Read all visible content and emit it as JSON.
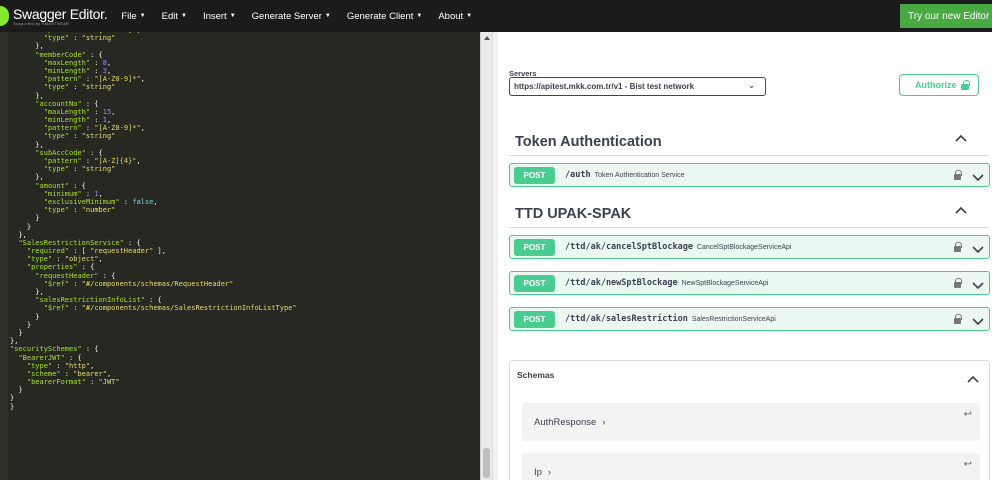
{
  "topbar": {
    "logo_title": "Swagger Editor.",
    "logo_sub": "Supported by SMARTBEAR",
    "menu": [
      "File",
      "Edit",
      "Insert",
      "Generate Server",
      "Generate Client",
      "About"
    ],
    "try_button": "Try our new Editor ↗"
  },
  "editor": {
    "lines": [
      [
        [
          "p",
          "        "
        ],
        [
          "k",
          "\"pattern\""
        ],
        [
          "p",
          " : "
        ],
        [
          "s",
          "\"[A-Z0-9]\""
        ],
        [
          "p",
          ","
        ]
      ],
      [
        [
          "p",
          "        "
        ],
        [
          "k",
          "\"type\""
        ],
        [
          "p",
          " : "
        ],
        [
          "s",
          "\"string\""
        ]
      ],
      [
        [
          "p",
          "      },"
        ]
      ],
      [
        [
          "p",
          "      "
        ],
        [
          "k",
          "\"memberCode\""
        ],
        [
          "p",
          " : {"
        ]
      ],
      [
        [
          "p",
          "        "
        ],
        [
          "k",
          "\"maxLength\""
        ],
        [
          "p",
          " : "
        ],
        [
          "n",
          "8"
        ],
        [
          "p",
          ","
        ]
      ],
      [
        [
          "p",
          "        "
        ],
        [
          "k",
          "\"minLength\""
        ],
        [
          "p",
          " : "
        ],
        [
          "n",
          "3"
        ],
        [
          "p",
          ","
        ]
      ],
      [
        [
          "p",
          "        "
        ],
        [
          "k",
          "\"pattern\""
        ],
        [
          "p",
          " : "
        ],
        [
          "s",
          "\"[A-Z0-9]*\""
        ],
        [
          "p",
          ","
        ]
      ],
      [
        [
          "p",
          "        "
        ],
        [
          "k",
          "\"type\""
        ],
        [
          "p",
          " : "
        ],
        [
          "s",
          "\"string\""
        ]
      ],
      [
        [
          "p",
          "      },"
        ]
      ],
      [
        [
          "p",
          "      "
        ],
        [
          "k",
          "\"accountNo\""
        ],
        [
          "p",
          " : {"
        ]
      ],
      [
        [
          "p",
          "        "
        ],
        [
          "k",
          "\"maxLength\""
        ],
        [
          "p",
          " : "
        ],
        [
          "n",
          "15"
        ],
        [
          "p",
          ","
        ]
      ],
      [
        [
          "p",
          "        "
        ],
        [
          "k",
          "\"minLength\""
        ],
        [
          "p",
          " : "
        ],
        [
          "n",
          "1"
        ],
        [
          "p",
          ","
        ]
      ],
      [
        [
          "p",
          "        "
        ],
        [
          "k",
          "\"pattern\""
        ],
        [
          "p",
          " : "
        ],
        [
          "s",
          "\"[A-Z0-9]*\""
        ],
        [
          "p",
          ","
        ]
      ],
      [
        [
          "p",
          "        "
        ],
        [
          "k",
          "\"type\""
        ],
        [
          "p",
          " : "
        ],
        [
          "s",
          "\"string\""
        ]
      ],
      [
        [
          "p",
          "      },"
        ]
      ],
      [
        [
          "p",
          "      "
        ],
        [
          "k",
          "\"subAccCode\""
        ],
        [
          "p",
          " : {"
        ]
      ],
      [
        [
          "p",
          "        "
        ],
        [
          "k",
          "\"pattern\""
        ],
        [
          "p",
          " : "
        ],
        [
          "s",
          "\"[A-Z]{4}\""
        ],
        [
          "p",
          ","
        ]
      ],
      [
        [
          "p",
          "        "
        ],
        [
          "k",
          "\"type\""
        ],
        [
          "p",
          " : "
        ],
        [
          "s",
          "\"string\""
        ]
      ],
      [
        [
          "p",
          "      },"
        ]
      ],
      [
        [
          "p",
          "      "
        ],
        [
          "k",
          "\"amount\""
        ],
        [
          "p",
          " : {"
        ]
      ],
      [
        [
          "p",
          "        "
        ],
        [
          "k",
          "\"minimum\""
        ],
        [
          "p",
          " : "
        ],
        [
          "n",
          "1"
        ],
        [
          "p",
          ","
        ]
      ],
      [
        [
          "p",
          "        "
        ],
        [
          "k",
          "\"exclusiveMinimum\""
        ],
        [
          "p",
          " : "
        ],
        [
          "kw",
          "false"
        ],
        [
          "p",
          ","
        ]
      ],
      [
        [
          "p",
          "        "
        ],
        [
          "k",
          "\"type\""
        ],
        [
          "p",
          " : "
        ],
        [
          "s",
          "\"number\""
        ]
      ],
      [
        [
          "p",
          "      }"
        ]
      ],
      [
        [
          "p",
          "    }"
        ]
      ],
      [
        [
          "p",
          "  },"
        ]
      ],
      [
        [
          "p",
          "  "
        ],
        [
          "k",
          "\"SalesRestrictionService\""
        ],
        [
          "p",
          " : {"
        ]
      ],
      [
        [
          "p",
          "    "
        ],
        [
          "k",
          "\"required\""
        ],
        [
          "p",
          " : [ "
        ],
        [
          "s",
          "\"requestHeader\""
        ],
        [
          "p",
          " ],"
        ]
      ],
      [
        [
          "p",
          "    "
        ],
        [
          "k",
          "\"type\""
        ],
        [
          "p",
          " : "
        ],
        [
          "s",
          "\"object\""
        ],
        [
          "p",
          ","
        ]
      ],
      [
        [
          "p",
          "    "
        ],
        [
          "k",
          "\"properties\""
        ],
        [
          "p",
          " : {"
        ]
      ],
      [
        [
          "p",
          "      "
        ],
        [
          "k",
          "\"requestHeader\""
        ],
        [
          "p",
          " : {"
        ]
      ],
      [
        [
          "p",
          "        "
        ],
        [
          "k",
          "\"$ref\""
        ],
        [
          "p",
          " : "
        ],
        [
          "s",
          "\"#/components/schemas/RequestHeader\""
        ]
      ],
      [
        [
          "p",
          "      },"
        ]
      ],
      [
        [
          "p",
          "      "
        ],
        [
          "k",
          "\"salesRestrictionInfoList\""
        ],
        [
          "p",
          " : {"
        ]
      ],
      [
        [
          "p",
          "        "
        ],
        [
          "k",
          "\"$ref\""
        ],
        [
          "p",
          " : "
        ],
        [
          "s",
          "\"#/components/schemas/SalesRestrictionInfoListType\""
        ]
      ],
      [
        [
          "p",
          "      }"
        ]
      ],
      [
        [
          "p",
          "    }"
        ]
      ],
      [
        [
          "p",
          "  }"
        ]
      ],
      [
        [
          "p",
          "},"
        ]
      ],
      [
        [
          "k",
          "\"securitySchemes\""
        ],
        [
          "p",
          " : {"
        ]
      ],
      [
        [
          "p",
          "  "
        ],
        [
          "k",
          "\"BearerJWT\""
        ],
        [
          "p",
          " : {"
        ]
      ],
      [
        [
          "p",
          "    "
        ],
        [
          "k",
          "\"type\""
        ],
        [
          "p",
          " : "
        ],
        [
          "s",
          "\"http\""
        ],
        [
          "p",
          ","
        ]
      ],
      [
        [
          "p",
          "    "
        ],
        [
          "k",
          "\"scheme\""
        ],
        [
          "p",
          " : "
        ],
        [
          "s",
          "\"bearer\""
        ],
        [
          "p",
          ","
        ]
      ],
      [
        [
          "p",
          "    "
        ],
        [
          "k",
          "\"bearerFormat\""
        ],
        [
          "p",
          " : "
        ],
        [
          "s",
          "\"JWT\""
        ]
      ],
      [
        [
          "p",
          "  }"
        ]
      ],
      [
        [
          "p",
          "}"
        ]
      ],
      [
        [
          "p",
          "}"
        ]
      ]
    ]
  },
  "panel": {
    "servers_label": "Servers",
    "server_value": "https://apitest.mkk.com.tr/v1 - Bist test network",
    "authorize_label": "Authorize",
    "tags": [
      {
        "title": "Token Authentication",
        "ops": [
          {
            "method": "POST",
            "path": "/auth",
            "summary": "Token Authentication Service"
          }
        ]
      },
      {
        "title": "TTD UPAK-SPAK",
        "ops": [
          {
            "method": "POST",
            "path": "/ttd/ak/cancelSptBlockage",
            "summary": "CancelSptBlockageServiceApi"
          },
          {
            "method": "POST",
            "path": "/ttd/ak/newSptBlockage",
            "summary": "NewSptBlockageServiceApi"
          },
          {
            "method": "POST",
            "path": "/ttd/ak/salesRestriction",
            "summary": "SalesRestrictionServiceApi"
          }
        ]
      }
    ],
    "schemas_title": "Schemas",
    "models": [
      "AuthResponse",
      "Ip"
    ]
  },
  "colors": {
    "post_green": "#49cc90",
    "editor_bg": "#272822",
    "topbar_bg": "#1b1b1b",
    "try_button": "#49a942"
  }
}
